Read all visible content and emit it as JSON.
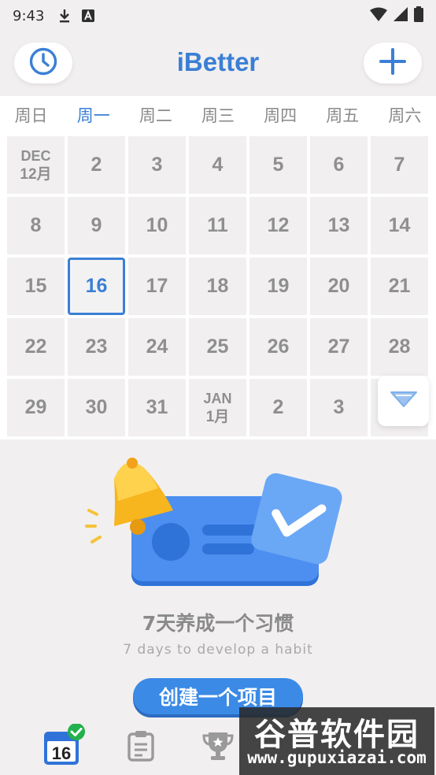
{
  "status_bar": {
    "time": "9:43"
  },
  "header": {
    "title": "iBetter"
  },
  "weekdays": [
    "周日",
    "周一",
    "周二",
    "周三",
    "周四",
    "周五",
    "周六"
  ],
  "active_weekday_index": 1,
  "calendar": {
    "rows": [
      [
        {
          "top": "DEC",
          "bottom": "12月"
        },
        "2",
        "3",
        "4",
        "5",
        "6",
        "7"
      ],
      [
        "8",
        "9",
        "10",
        "11",
        "12",
        "13",
        "14"
      ],
      [
        "15",
        "16",
        "17",
        "18",
        "19",
        "20",
        "21"
      ],
      [
        "22",
        "23",
        "24",
        "25",
        "26",
        "27",
        "28"
      ],
      [
        "29",
        "30",
        "31",
        {
          "top": "JAN",
          "bottom": "1月"
        },
        "2",
        "3",
        ""
      ]
    ],
    "today": "16"
  },
  "empty_state": {
    "title": "7天养成一个习惯",
    "subtitle": "7 days to develop a habit",
    "create_button": "创建一个项目"
  },
  "tabbar": {
    "calendar_day": "16"
  },
  "watermark": {
    "cn": "谷普软件园",
    "url": "www.gupuxiazai.com"
  },
  "colors": {
    "accent": "#3a7fd5",
    "background": "#f1efef",
    "cell": "#f1efef",
    "button": "#3a8ae6"
  }
}
